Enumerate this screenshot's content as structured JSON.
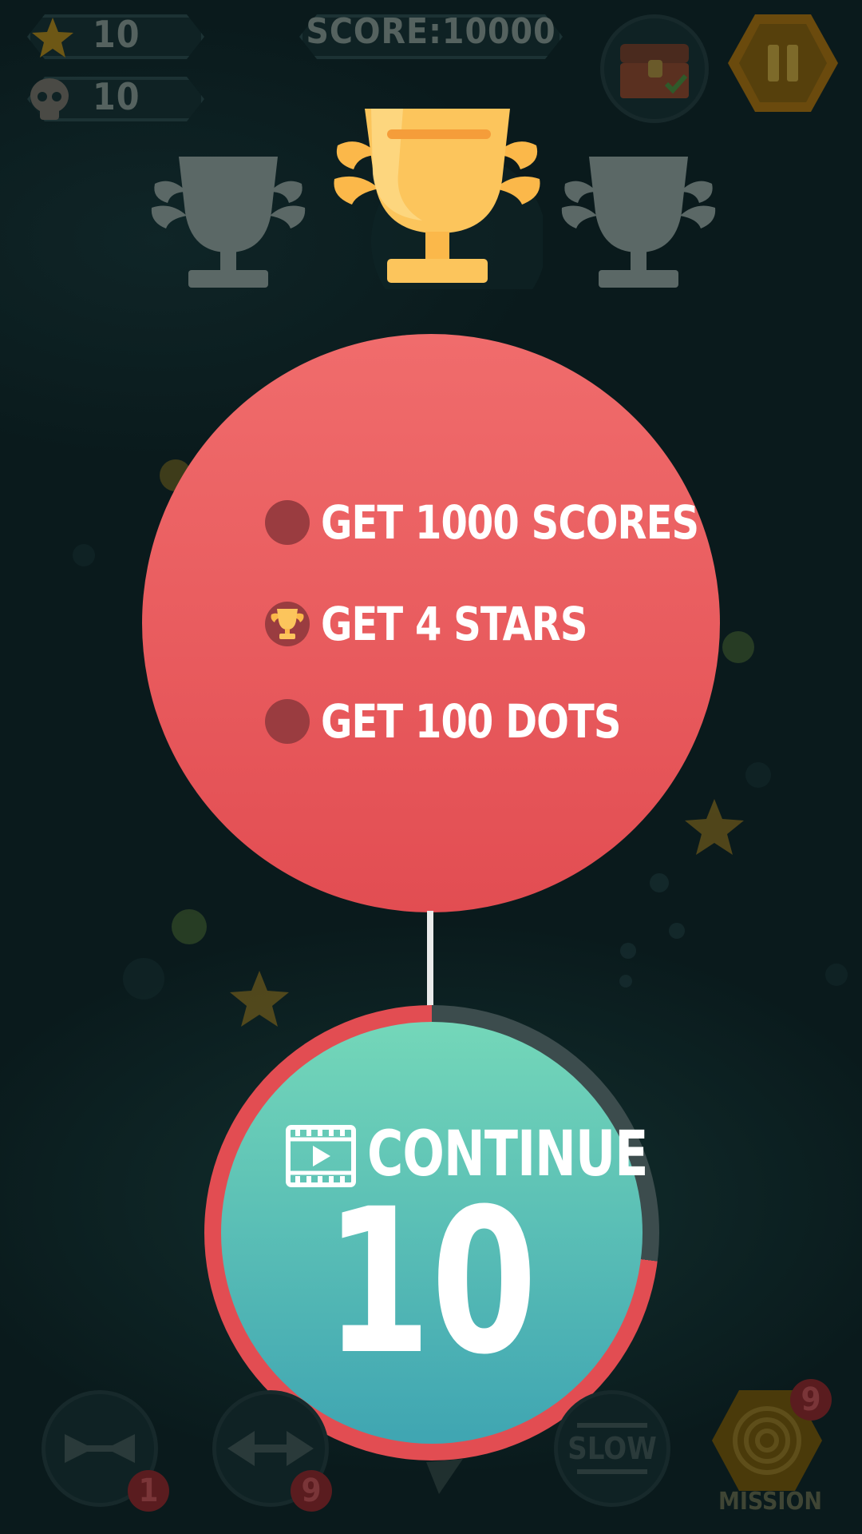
{
  "hud": {
    "stars_count": "10",
    "deaths_count": "10",
    "score_text": "SCORE:10000"
  },
  "missions": [
    {
      "label": "GET 1000 SCORES",
      "completed": false
    },
    {
      "label": "GET 4 STARS",
      "completed": true
    },
    {
      "label": "GET 100 DOTS",
      "completed": false
    }
  ],
  "trophies": {
    "earned": 1,
    "total": 3
  },
  "continue": {
    "label": "CONTINUE",
    "countdown": "10",
    "timer_remaining_fraction": 0.73
  },
  "powerups": [
    {
      "name": "shrink",
      "badge": "1"
    },
    {
      "name": "widen",
      "badge": "9"
    },
    {
      "name": "slow",
      "label": "SLOW"
    }
  ],
  "mission_button": {
    "label": "MISSION",
    "badge": "9"
  },
  "colors": {
    "mission_circle": "#e85a5c",
    "continue_circle_top": "#74d7b9",
    "continue_circle_bottom": "#3fa5b2",
    "trophy_gold": "#fbc55c",
    "trophy_dim": "#6a7572"
  }
}
